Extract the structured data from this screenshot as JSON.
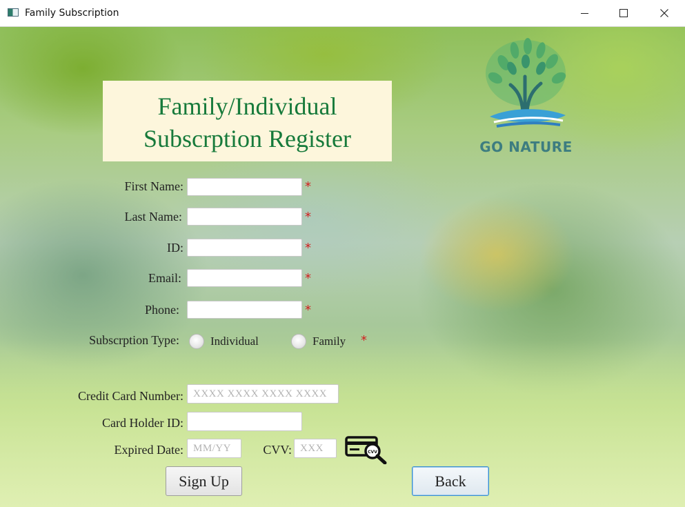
{
  "window": {
    "title": "Family Subscription",
    "controls": {
      "minimize": "minimize",
      "maximize": "maximize",
      "close": "close"
    }
  },
  "logo": {
    "text": "GO NATURE"
  },
  "heading": {
    "line1": "Family/Individual",
    "line2": "Subscrption Register"
  },
  "form": {
    "first_name_label": "First Name:",
    "last_name_label": "Last Name:",
    "id_label": "ID:",
    "email_label": "Email:",
    "phone_label": "Phone:",
    "required_mark": "*",
    "subscription_type_label": "Subscrption Type:",
    "subscription_options": [
      "Individual",
      "Family"
    ],
    "credit_card_label": "Credit Card Number:",
    "credit_card_placeholder": "XXXX XXXX XXXX XXXX",
    "card_holder_label": "Card Holder ID:",
    "expired_date_label": "Expired Date:",
    "expired_date_placeholder": "MM/YY",
    "cvv_label": "CVV:",
    "cvv_placeholder": "XXX",
    "cvv_icon_text": "CVV"
  },
  "buttons": {
    "sign_up": "Sign Up",
    "back": "Back"
  },
  "colors": {
    "heading_text": "#177a3b",
    "heading_bg": "#fdf6dc",
    "required": "#d21f1f",
    "back_border": "#3a8fd0"
  }
}
